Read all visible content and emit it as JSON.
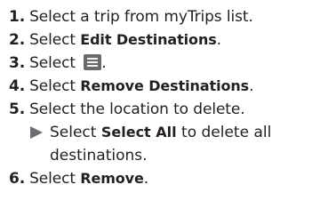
{
  "steps": [
    {
      "num": "1.",
      "text": "Select a trip from myTrips list."
    },
    {
      "num": "2.",
      "pre": "Select ",
      "bold": "Edit Destinations",
      "post": "."
    },
    {
      "num": "3.",
      "pre": "Select ",
      "icon": "menu-icon",
      "post": "."
    },
    {
      "num": "4.",
      "pre": "Select ",
      "bold": "Remove Destinations",
      "post": "."
    },
    {
      "num": "5.",
      "text": "Select the location to delete."
    },
    {
      "num": "6.",
      "pre": "Select ",
      "bold": "Remove",
      "post": "."
    }
  ],
  "substep": {
    "icon": "triangle-bullet-icon",
    "pre": "Select ",
    "bold": "Select All",
    "line1_post": " to delete all",
    "line2": "destinations."
  },
  "colors": {
    "text": "#231f20",
    "icon_bg": "#6a6a6a",
    "bullet": "#6d6e71"
  }
}
